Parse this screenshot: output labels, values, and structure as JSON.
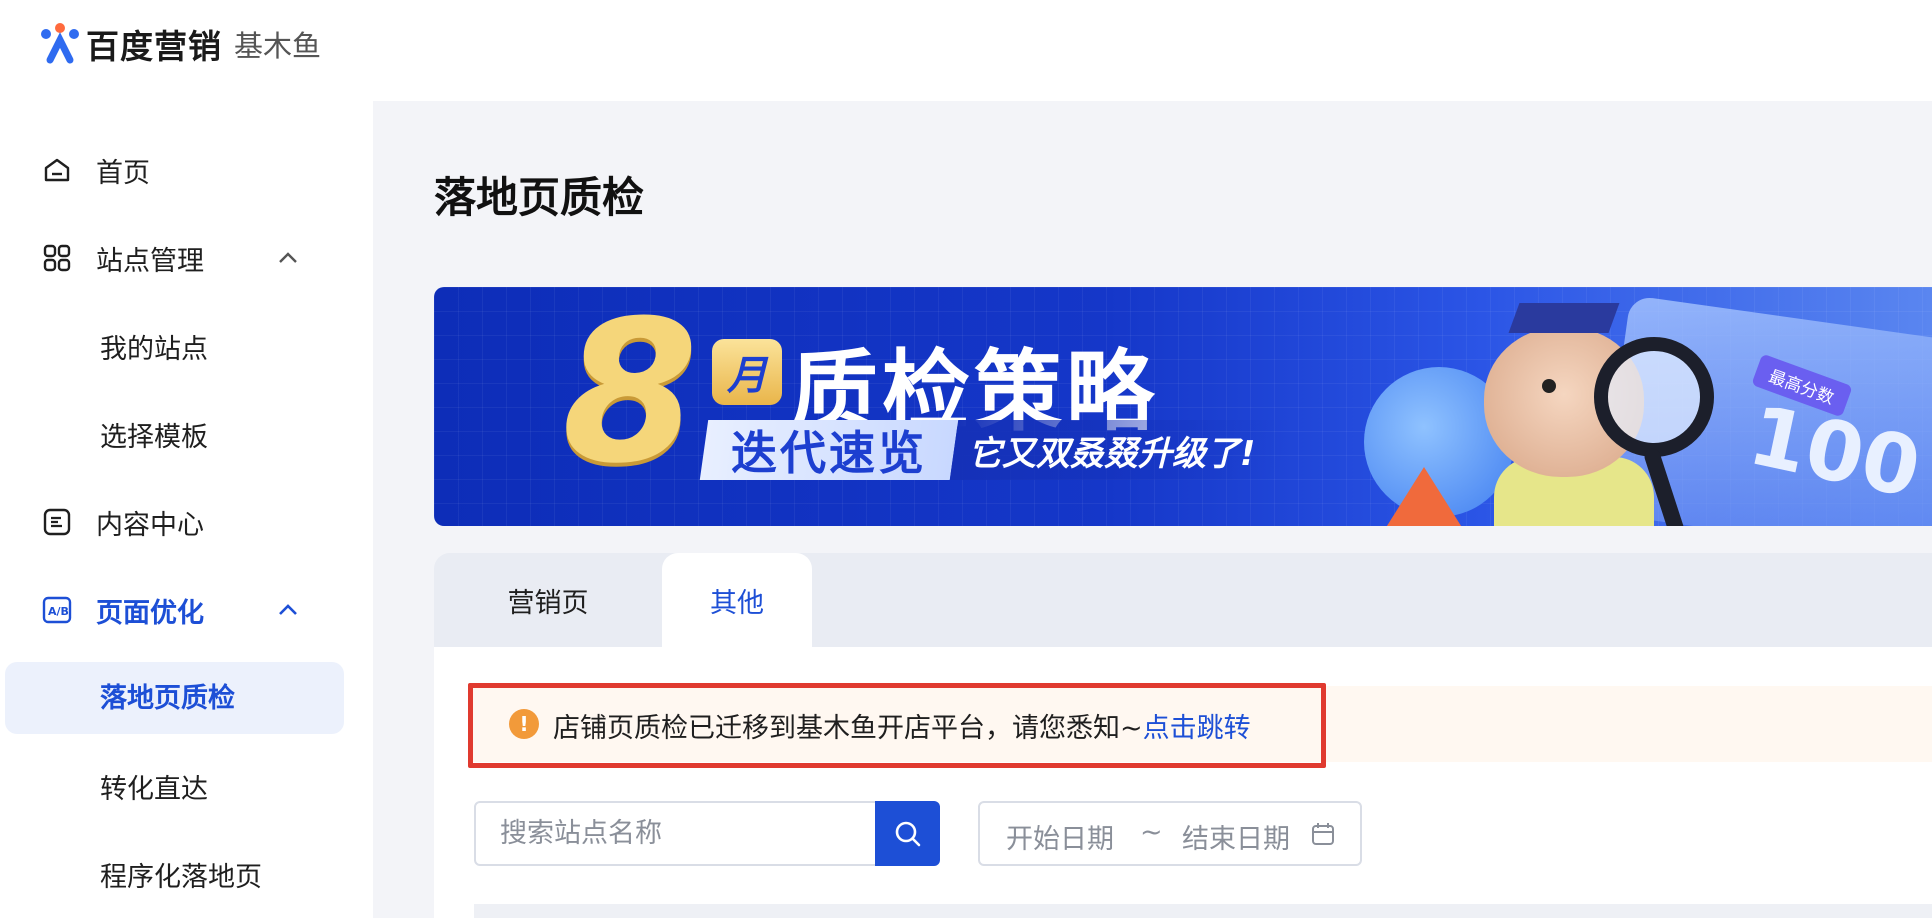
{
  "brand": {
    "name": "百度营销",
    "product": "基木鱼"
  },
  "sidebar": {
    "items": [
      {
        "label": "首页",
        "icon": "home-icon"
      },
      {
        "label": "站点管理",
        "icon": "grid-icon",
        "expanded": true
      },
      {
        "label": "我的站点",
        "sub": true
      },
      {
        "label": "选择模板",
        "sub": true
      },
      {
        "label": "内容中心",
        "icon": "document-icon"
      },
      {
        "label": "页面优化",
        "icon": "ab-test-icon",
        "expanded": true,
        "active_parent": true
      },
      {
        "label": "落地页质检",
        "sub": true,
        "active": true
      },
      {
        "label": "转化直达",
        "sub": true
      },
      {
        "label": "程序化落地页",
        "sub": true
      }
    ]
  },
  "page": {
    "title": "落地页质检"
  },
  "banner": {
    "number": "8",
    "month": "月",
    "headline": "质检策略",
    "sub_left": "迭代速览",
    "sub_right": "它又双叒叕升级了!",
    "score_tag": "最高分数",
    "score_value": "100"
  },
  "tabs": [
    {
      "label": "营销页",
      "active": false
    },
    {
      "label": "其他",
      "active": true
    }
  ],
  "notice": {
    "text": "店铺页质检已迁移到基木鱼开店平台，请您悉知~",
    "link": "点击跳转"
  },
  "search": {
    "placeholder": "搜索站点名称",
    "value": ""
  },
  "date_range": {
    "start": "开始日期",
    "separator": "~",
    "end": "结束日期"
  },
  "colors": {
    "accent": "#1d4fd6",
    "warning": "#f29a3a",
    "highlight_outline": "#e03a2f"
  }
}
